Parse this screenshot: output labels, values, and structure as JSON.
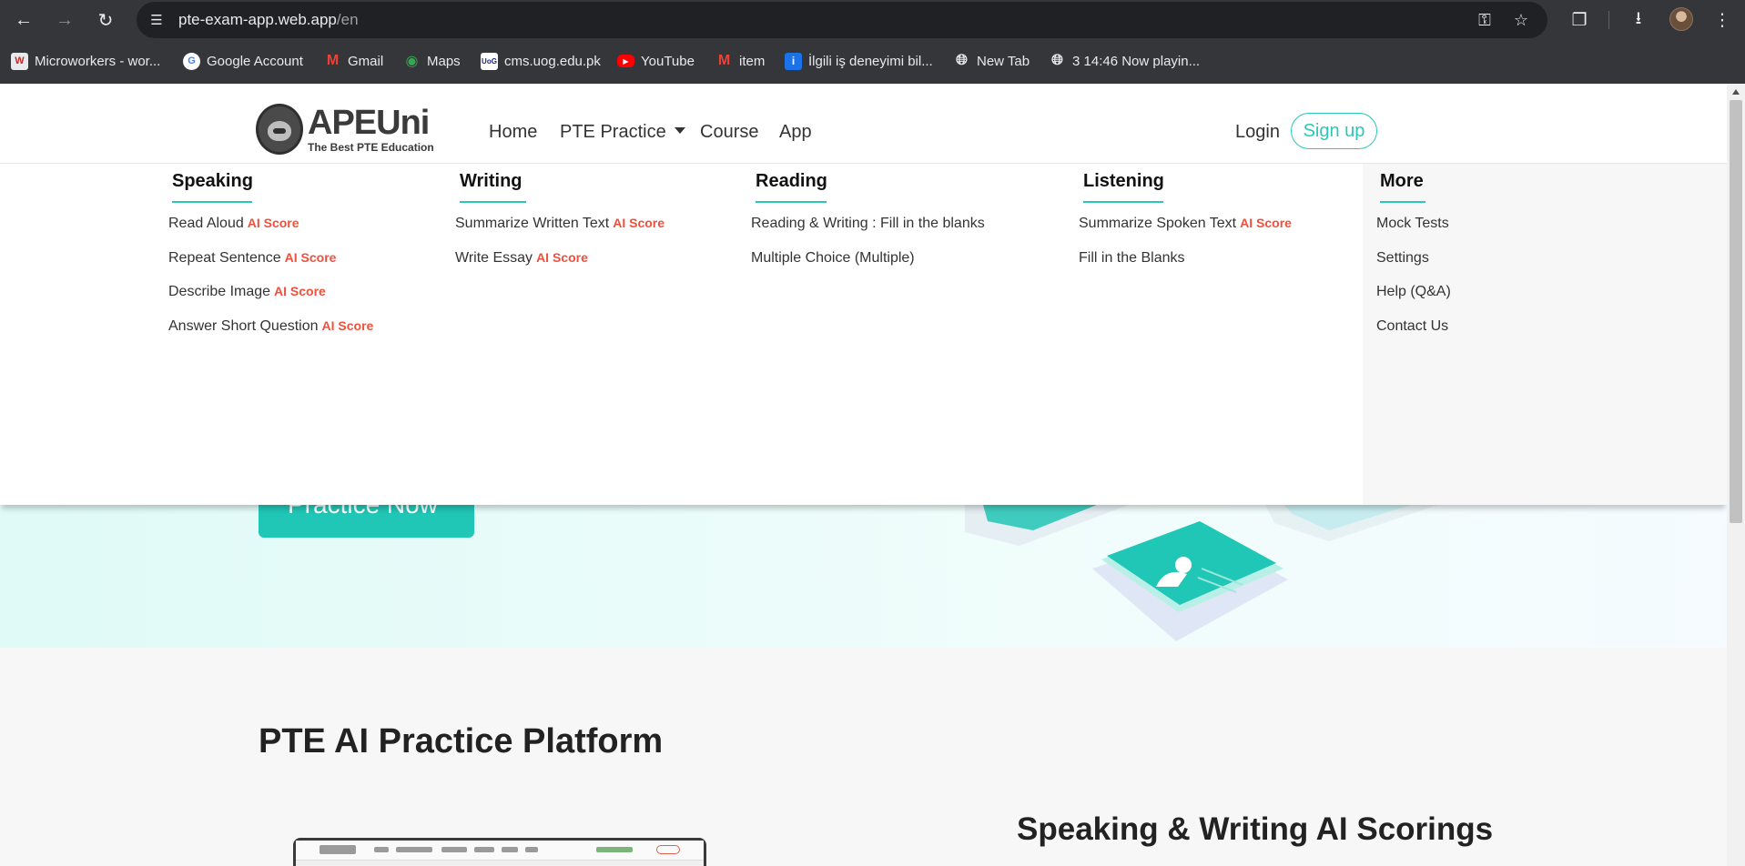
{
  "browser": {
    "url_host": "pte-exam-app.web.app",
    "url_path": "/en",
    "bookmarks": [
      {
        "label": "Microworkers - wor...",
        "icon": "microworkers-icon"
      },
      {
        "label": "Google Account",
        "icon": "google-icon"
      },
      {
        "label": "Gmail",
        "icon": "gmail-icon"
      },
      {
        "label": "Maps",
        "icon": "maps-icon"
      },
      {
        "label": "cms.uog.edu.pk",
        "icon": "uog-icon"
      },
      {
        "label": "YouTube",
        "icon": "youtube-icon"
      },
      {
        "label": "item",
        "icon": "gmail-icon"
      },
      {
        "label": "İlgili iş deneyimi bil...",
        "icon": "bookmark-info-icon"
      },
      {
        "label": "New Tab",
        "icon": "globe-icon"
      },
      {
        "label": "3 14:46 Now playin...",
        "icon": "globe-icon"
      }
    ]
  },
  "site": {
    "logo_text": "APEUni",
    "logo_tagline": "The Best PTE Education",
    "nav": [
      {
        "label": "Home"
      },
      {
        "label": "PTE Practice"
      },
      {
        "label": "Course"
      },
      {
        "label": "App"
      }
    ],
    "login": "Login",
    "signup": "Sign up"
  },
  "menu": {
    "ai_badge": "AI Score",
    "columns": [
      {
        "title": "Speaking",
        "items": [
          {
            "label": "Read Aloud",
            "ai": true
          },
          {
            "label": "Repeat Sentence",
            "ai": true
          },
          {
            "label": "Describe Image",
            "ai": true
          },
          {
            "label": "Answer Short Question",
            "ai": true
          }
        ]
      },
      {
        "title": "Writing",
        "items": [
          {
            "label": "Summarize Written Text",
            "ai": true
          },
          {
            "label": "Write Essay",
            "ai": true
          }
        ]
      },
      {
        "title": "Reading",
        "items": [
          {
            "label": "Reading & Writing : Fill in the blanks",
            "ai": false
          },
          {
            "label": "Multiple Choice (Multiple)",
            "ai": false
          }
        ]
      },
      {
        "title": "Listening",
        "items": [
          {
            "label": "Summarize Spoken Text",
            "ai": true
          },
          {
            "label": "Fill in the Blanks",
            "ai": false
          }
        ]
      },
      {
        "title": "More",
        "items": [
          {
            "label": "Mock Tests",
            "ai": false
          },
          {
            "label": "Settings",
            "ai": false
          },
          {
            "label": "Help (Q&A)",
            "ai": false
          },
          {
            "label": "Contact Us",
            "ai": false
          }
        ]
      }
    ]
  },
  "hero": {
    "cta": "Practice Now"
  },
  "section": {
    "title": "PTE AI Practice Platform",
    "subhead": "Speaking & Writing AI Scorings"
  },
  "colors": {
    "accent": "#2cc7b8",
    "ai_badge": "#f0503c",
    "chrome": "#35363a"
  }
}
